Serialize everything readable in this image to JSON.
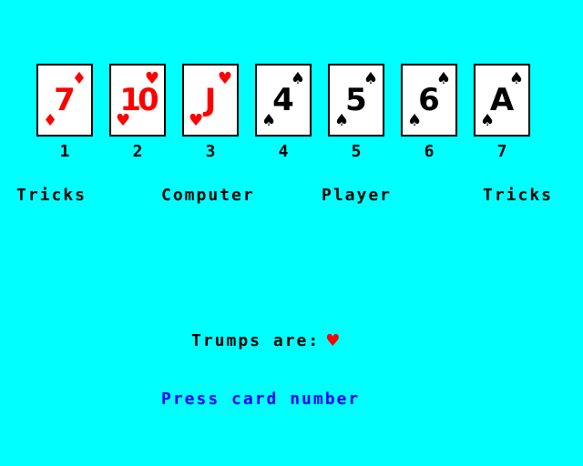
{
  "cards": [
    {
      "number": "1",
      "rank": "7",
      "suit": "♦",
      "color": "#ff0000"
    },
    {
      "number": "2",
      "rank": "10",
      "suit": "♥",
      "color": "#ff0000"
    },
    {
      "number": "3",
      "rank": "J",
      "suit": "♥",
      "color": "#ff0000"
    },
    {
      "number": "4",
      "rank": "4",
      "suit": "♠",
      "color": "#000000"
    },
    {
      "number": "5",
      "rank": "5",
      "suit": "♠",
      "color": "#000000"
    },
    {
      "number": "6",
      "rank": "6",
      "suit": "♠",
      "color": "#000000"
    },
    {
      "number": "7",
      "rank": "A",
      "suit": "♠",
      "color": "#000000"
    }
  ],
  "labels": {
    "tricks_left": "Tricks",
    "computer": "Computer",
    "player": "Player",
    "tricks_right": "Tricks"
  },
  "trumps": {
    "label": "Trumps are:",
    "suit": "♥",
    "suit_color": "#ff0000"
  },
  "prompt": "Press card number",
  "colors": {
    "background": "#00ffff",
    "prompt": "#0000ff"
  }
}
